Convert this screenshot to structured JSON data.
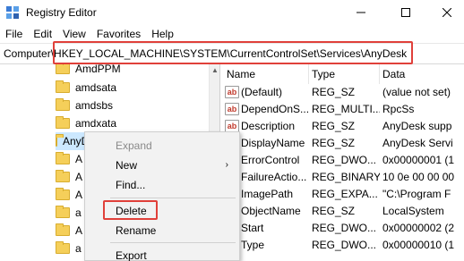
{
  "window": {
    "title": "Registry Editor",
    "minimize": "—",
    "maximize": "☐",
    "close": "✕",
    "app_icon": "registry-icon"
  },
  "menubar": {
    "items": [
      "File",
      "Edit",
      "View",
      "Favorites",
      "Help"
    ]
  },
  "address": {
    "label": "Computer\\",
    "path": "HKEY_LOCAL_MACHINE\\SYSTEM\\CurrentControlSet\\Services\\AnyDesk",
    "highlight_color": "#e0403a"
  },
  "tree": {
    "items": [
      {
        "label": "AmdPPM"
      },
      {
        "label": "amdsata"
      },
      {
        "label": "amdsbs"
      },
      {
        "label": "amdxata"
      },
      {
        "label": "AnyDesk",
        "selected": true
      },
      {
        "label": "A"
      },
      {
        "label": "A"
      },
      {
        "label": "A"
      },
      {
        "label": "a"
      },
      {
        "label": "A"
      },
      {
        "label": "a"
      }
    ]
  },
  "values": {
    "headers": {
      "name": "Name",
      "type": "Type",
      "data": "Data"
    },
    "rows": [
      {
        "icon": "ab",
        "name": "(Default)",
        "type": "REG_SZ",
        "data": "(value not set)"
      },
      {
        "icon": "ab",
        "name": "DependOnS...",
        "type": "REG_MULTI...",
        "data": "RpcSs"
      },
      {
        "icon": "ab",
        "name": "Description",
        "type": "REG_SZ",
        "data": "AnyDesk supp"
      },
      {
        "icon": "ab",
        "name": "DisplayName",
        "type": "REG_SZ",
        "data": "AnyDesk Servi"
      },
      {
        "icon": "bin",
        "name": "ErrorControl",
        "type": "REG_DWO...",
        "data": "0x00000001 (1"
      },
      {
        "icon": "bin",
        "name": "FailureActio...",
        "type": "REG_BINARY",
        "data": "10 0e 00 00 00"
      },
      {
        "icon": "ab",
        "name": "ImagePath",
        "type": "REG_EXPA...",
        "data": "\"C:\\Program F"
      },
      {
        "icon": "ab",
        "name": "ObjectName",
        "type": "REG_SZ",
        "data": "LocalSystem"
      },
      {
        "icon": "bin",
        "name": "Start",
        "type": "REG_DWO...",
        "data": "0x00000002 (2"
      },
      {
        "icon": "bin",
        "name": "Type",
        "type": "REG_DWO...",
        "data": "0x00000010 (1"
      }
    ]
  },
  "context_menu": {
    "expand": "Expand",
    "new": "New",
    "new_arrow": "›",
    "find": "Find...",
    "delete": "Delete",
    "rename": "Rename",
    "export": "Export"
  }
}
